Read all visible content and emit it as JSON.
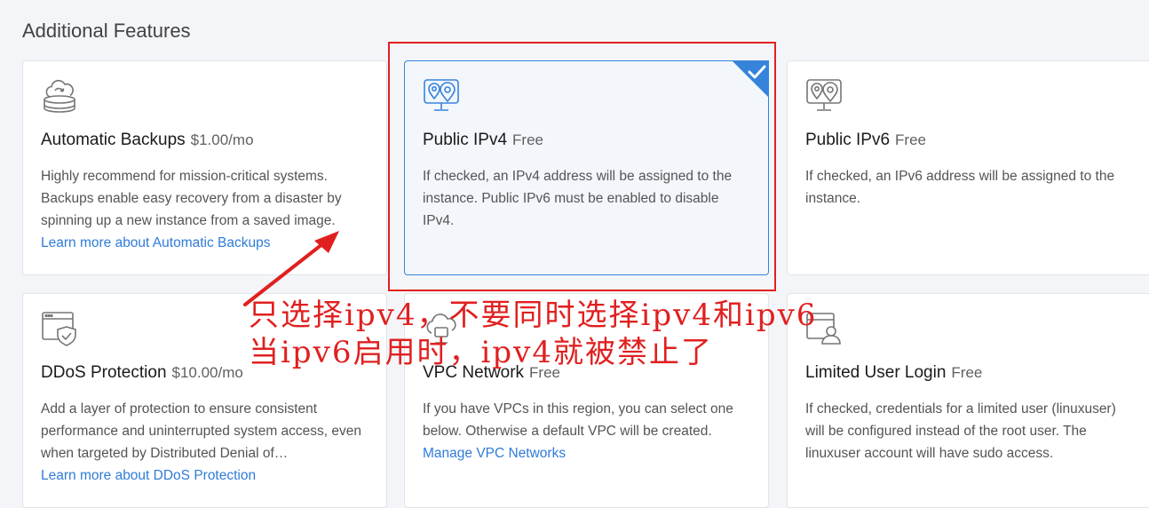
{
  "section_title": "Additional Features",
  "accent_color": "#3683dc",
  "annotation_color": "#e02020",
  "cards": [
    {
      "id": "automatic-backups",
      "icon": "cloud-backup-icon",
      "title": "Automatic Backups",
      "price": "$1.00/mo",
      "description": "Highly recommend for mission-critical systems. Backups enable easy recovery from a disaster by spinning up a new instance from a saved image.",
      "link": "Learn more about Automatic Backups",
      "selected": false
    },
    {
      "id": "public-ipv4",
      "icon": "map-pin-monitor-icon",
      "title": "Public IPv4",
      "price": "Free",
      "description": "If checked, an IPv4 address will be assigned to the instance. Public IPv6 must be enabled to disable IPv4.",
      "selected": true
    },
    {
      "id": "public-ipv6",
      "icon": "map-pin-monitor-icon",
      "title": "Public IPv6",
      "price": "Free",
      "description": "If checked, an IPv6 address will be assigned to the instance.",
      "selected": false
    },
    {
      "id": "ddos-protection",
      "icon": "shield-window-icon",
      "title": "DDoS Protection",
      "price": "$10.00/mo",
      "description": "Add a layer of protection to ensure consistent performance and uninterrupted system access, even when targeted by Distributed Denial of…",
      "link": "Learn more about DDoS Protection",
      "selected": false
    },
    {
      "id": "vpc-network",
      "icon": "cloud-network-icon",
      "title": "VPC Network",
      "price": "Free",
      "description": "If you have VPCs in this region, you can select one below. Otherwise a default VPC will be created.",
      "link": "Manage VPC Networks",
      "selected": false
    },
    {
      "id": "limited-user-login",
      "icon": "user-login-icon",
      "title": "Limited User Login",
      "price": "Free",
      "description": "If checked, credentials for a limited user (linuxuser) will be configured instead of the root user. The linuxuser account will have sudo access.",
      "selected": false
    }
  ],
  "annotation": {
    "line1": "只选择ipv4，不要同时选择ipv4和ipv6",
    "line2": "当ipv6启用时，ipv4就被禁止了"
  }
}
